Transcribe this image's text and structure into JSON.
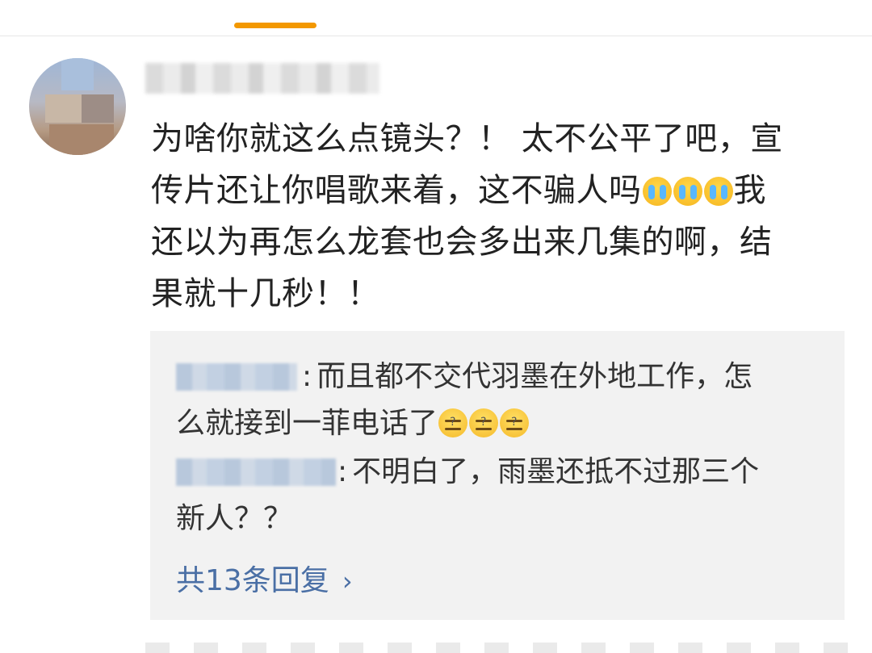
{
  "comment": {
    "line1": "为啥你就这么点镜头？！ 太不公平了吧，宣",
    "line2a": "传片还让你唱歌来着，这不骗人吗",
    "line2b": "我",
    "line3": "还以为再怎么龙套也会多出来几集的啊，结",
    "line4": "果就十几秒！！"
  },
  "emoji_names": [
    "crying-face",
    "crying-face",
    "crying-face",
    "dozing-face",
    "dozing-face",
    "dozing-face"
  ],
  "replies": [
    {
      "sep": ":",
      "text_a": "而且都不交代羽墨在外地工作，怎",
      "text_b": "么就接到一菲电话了"
    },
    {
      "sep": ":",
      "text_a": "不明白了，雨墨还抵不过那三个",
      "text_b": "新人？？"
    }
  ],
  "more_replies_label": "共13条回复",
  "colors": {
    "accent": "#f39800",
    "link": "#4a6fa5",
    "reply_bg": "#f2f2f2"
  }
}
